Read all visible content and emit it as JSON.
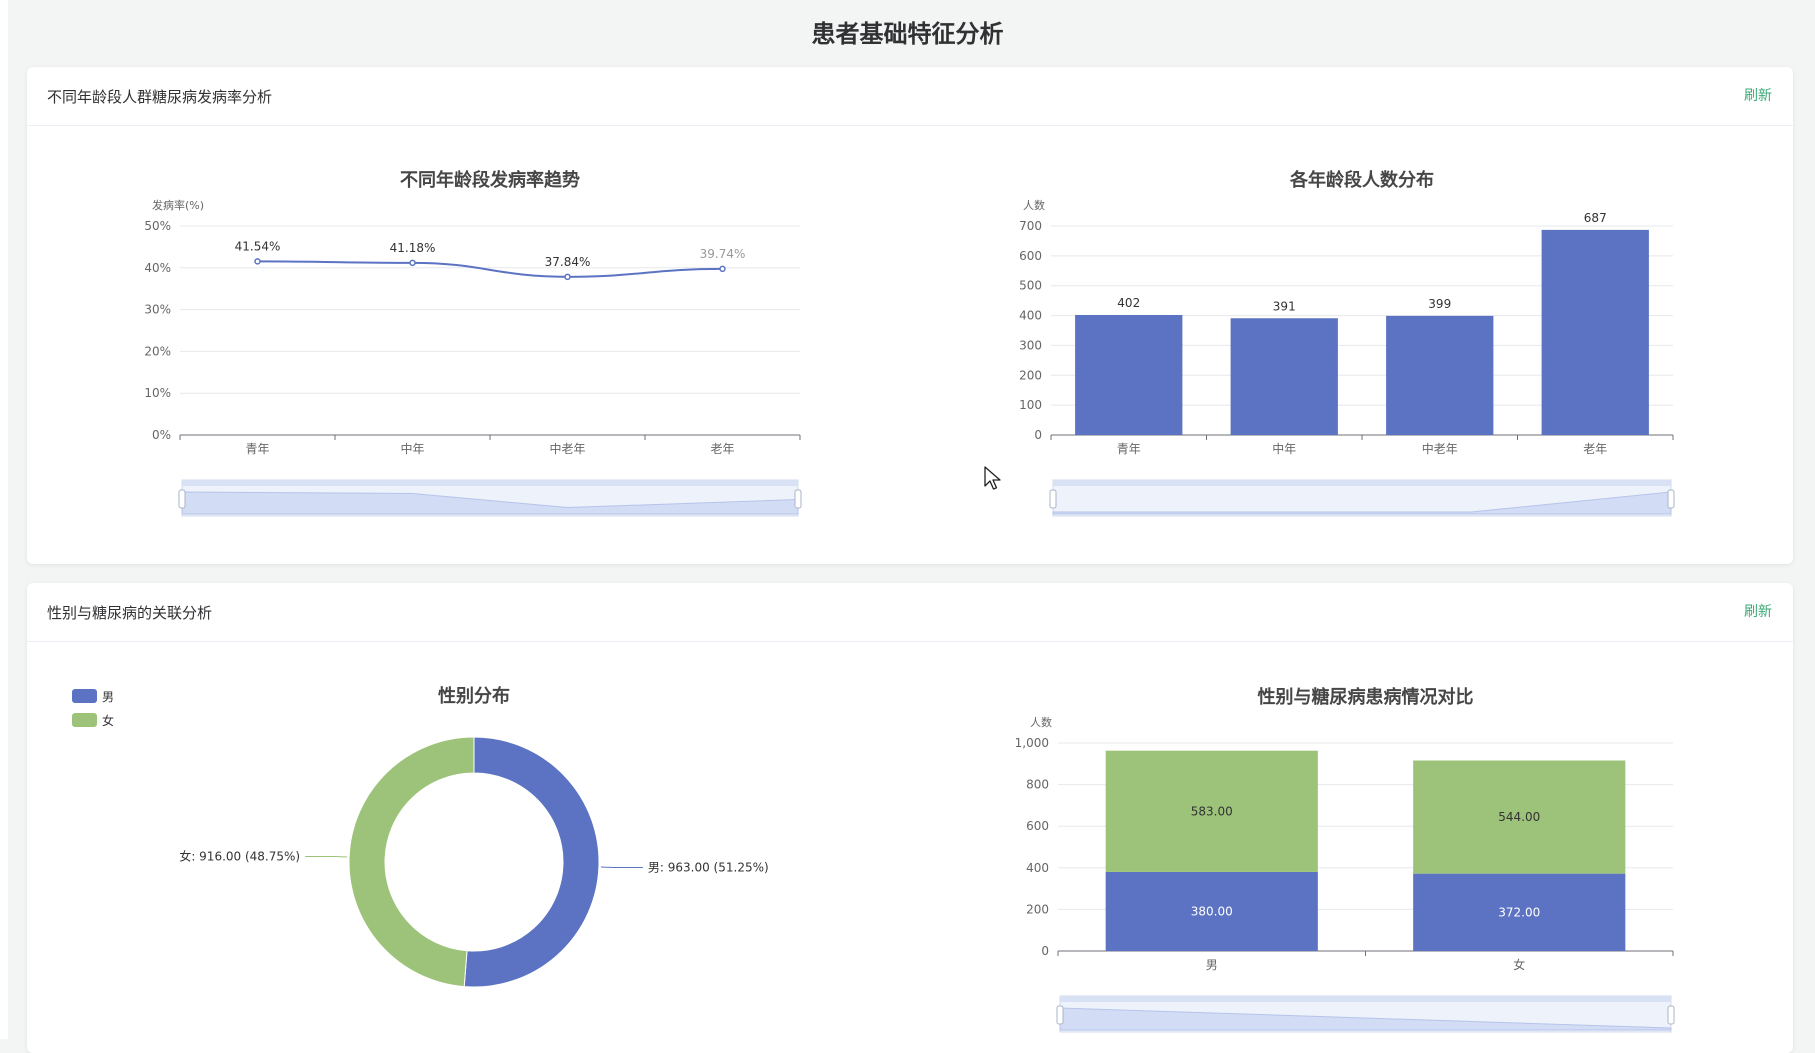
{
  "page": {
    "title": "患者基础特征分析"
  },
  "cards": [
    {
      "title": "不同年龄段人群糖尿病发病率分析",
      "refresh": "刷新"
    },
    {
      "title": "性别与糖尿病的关联分析",
      "refresh": "刷新"
    }
  ],
  "colors": {
    "blue": "#5b73c2",
    "green": "#9dc37a",
    "accent": "#3aa876"
  },
  "chart_data": [
    {
      "type": "line",
      "title": "不同年龄段发病率趋势",
      "ylabel": "发病率(%)",
      "categories": [
        "青年",
        "中年",
        "中老年",
        "老年"
      ],
      "values": [
        41.54,
        41.18,
        37.84,
        39.74
      ],
      "value_labels": [
        "41.54%",
        "41.18%",
        "37.84%",
        "39.74%"
      ],
      "ylim": [
        0,
        50
      ],
      "yticks": [
        "0%",
        "10%",
        "20%",
        "30%",
        "40%",
        "50%"
      ],
      "grid": true,
      "smooth": true
    },
    {
      "type": "bar",
      "title": "各年龄段人数分布",
      "ylabel": "人数",
      "categories": [
        "青年",
        "中年",
        "中老年",
        "老年"
      ],
      "values": [
        402,
        391,
        399,
        687
      ],
      "ylim": [
        0,
        700
      ],
      "yticks": [
        "0",
        "100",
        "200",
        "300",
        "400",
        "500",
        "600",
        "700"
      ],
      "grid": true
    },
    {
      "type": "pie",
      "title": "性别分布",
      "donut": true,
      "legend": "top-left",
      "slices": [
        {
          "name": "男",
          "value": 963,
          "label": "男: 963.00 (51.25%)"
        },
        {
          "name": "女",
          "value": 916,
          "label": "女: 916.00 (48.75%)"
        }
      ]
    },
    {
      "type": "bar",
      "stacked": true,
      "title": "性别与糖尿病患病情况对比",
      "ylabel": "人数",
      "categories": [
        "男",
        "女"
      ],
      "series": [
        {
          "values": [
            380,
            372
          ],
          "labels": [
            "380.00",
            "372.00"
          ]
        },
        {
          "values": [
            583,
            544
          ],
          "labels": [
            "583.00",
            "544.00"
          ]
        }
      ],
      "ylim": [
        0,
        1000
      ],
      "yticks": [
        "0",
        "200",
        "400",
        "600",
        "800",
        "1,000"
      ],
      "grid": true
    }
  ]
}
